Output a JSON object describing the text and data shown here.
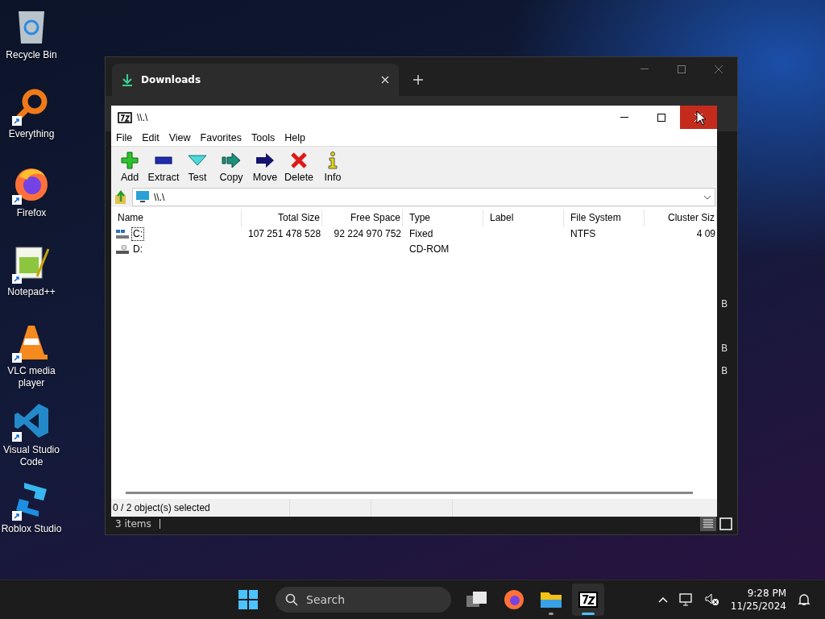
{
  "desktop_icons": [
    {
      "label": "Recycle Bin",
      "kind": "recycle",
      "shortcut": false
    },
    {
      "label": "Everything",
      "kind": "magnifier",
      "shortcut": true
    },
    {
      "label": "Firefox",
      "kind": "firefox",
      "shortcut": true
    },
    {
      "label": "Notepad++",
      "kind": "notepad",
      "shortcut": true
    },
    {
      "label": "VLC media player",
      "kind": "cone",
      "shortcut": true
    },
    {
      "label": "Visual Studio Code",
      "kind": "vscode",
      "shortcut": true
    },
    {
      "label": "Roblox Studio",
      "kind": "roblox",
      "shortcut": true
    }
  ],
  "explorer": {
    "tab": {
      "label": "Downloads",
      "selected": true
    },
    "side_fragments": [
      "B",
      "B",
      "B"
    ],
    "status": "3 items"
  },
  "sevenzip": {
    "title": "\\\\.\\",
    "menu": [
      "File",
      "Edit",
      "View",
      "Favorites",
      "Tools",
      "Help"
    ],
    "toolbar": [
      {
        "label": "Add",
        "kind": "add"
      },
      {
        "label": "Extract",
        "kind": "extract"
      },
      {
        "label": "Test",
        "kind": "test"
      },
      {
        "label": "Copy",
        "kind": "copy"
      },
      {
        "label": "Move",
        "kind": "move"
      },
      {
        "label": "Delete",
        "kind": "delete"
      },
      {
        "label": "Info",
        "kind": "info"
      }
    ],
    "address": "\\\\.\\",
    "columns": [
      "Name",
      "Total Size",
      "Free Space",
      "Type",
      "Label",
      "File System",
      "Cluster Siz"
    ],
    "rows": [
      {
        "kind": "fixed",
        "focused": true,
        "name": "C:",
        "total_size": "107 251 478 528",
        "free_space": "92 224 970 752",
        "type": "Fixed",
        "file_system": "NTFS",
        "cluster_size": "4 09"
      },
      {
        "kind": "cdrom",
        "focused": false,
        "name": "D:",
        "type": "CD-ROM"
      }
    ],
    "status": "0 / 2 object(s) selected"
  },
  "taskbar": {
    "search_placeholder": "Search",
    "apps": [
      {
        "kind": "taskview",
        "running": false,
        "active": false
      },
      {
        "kind": "firefox",
        "running": false,
        "active": false
      },
      {
        "kind": "folder",
        "running": true,
        "active": false
      },
      {
        "kind": "sevenzip",
        "running": true,
        "active": true
      }
    ],
    "time": "9:28 PM",
    "date": "11/25/2024"
  }
}
